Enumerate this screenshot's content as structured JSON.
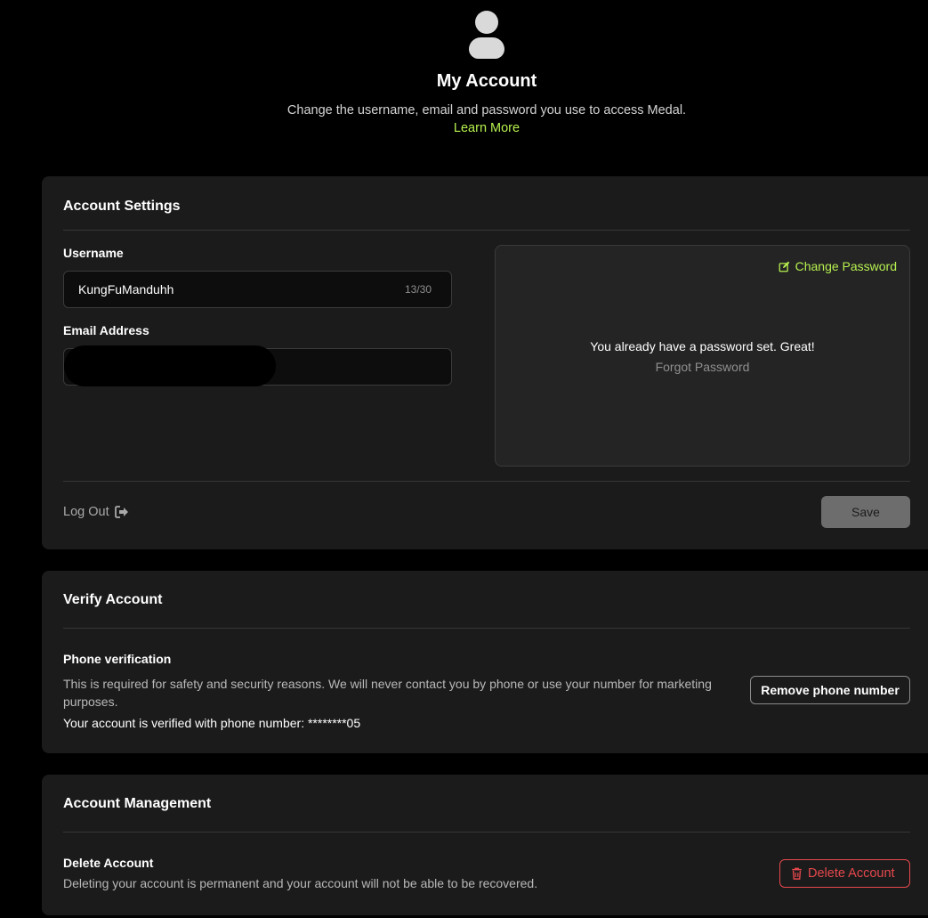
{
  "header": {
    "title": "My Account",
    "subtitle": "Change the username, email and password you use to access Medal.",
    "learn_more": "Learn More"
  },
  "account_settings": {
    "title": "Account Settings",
    "username_label": "Username",
    "username_value": "KungFuManduhh",
    "username_count": "13/30",
    "email_label": "Email Address",
    "change_password": "Change Password",
    "password_message": "You already have a password set. Great!",
    "forgot_password": "Forgot Password",
    "logout": "Log Out",
    "save": "Save"
  },
  "verify_account": {
    "title": "Verify Account",
    "phone_title": "Phone verification",
    "phone_desc": "This is required for safety and security reasons. We will never contact you by phone or use your number for marketing purposes.",
    "verified_text": "Your account is verified with phone number: ********05",
    "remove_button": "Remove phone number"
  },
  "account_management": {
    "title": "Account Management",
    "delete_title": "Delete Account",
    "delete_desc": "Deleting your account is permanent and your account will not be able to be recovered.",
    "delete_button": "Delete Account"
  },
  "colors": {
    "accent": "#b6f14f",
    "danger": "#e5484d",
    "card_bg": "#1b1b1b",
    "page_bg": "#000000"
  },
  "icons": [
    "user-avatar-icon",
    "edit-icon",
    "logout-icon",
    "trash-icon"
  ]
}
